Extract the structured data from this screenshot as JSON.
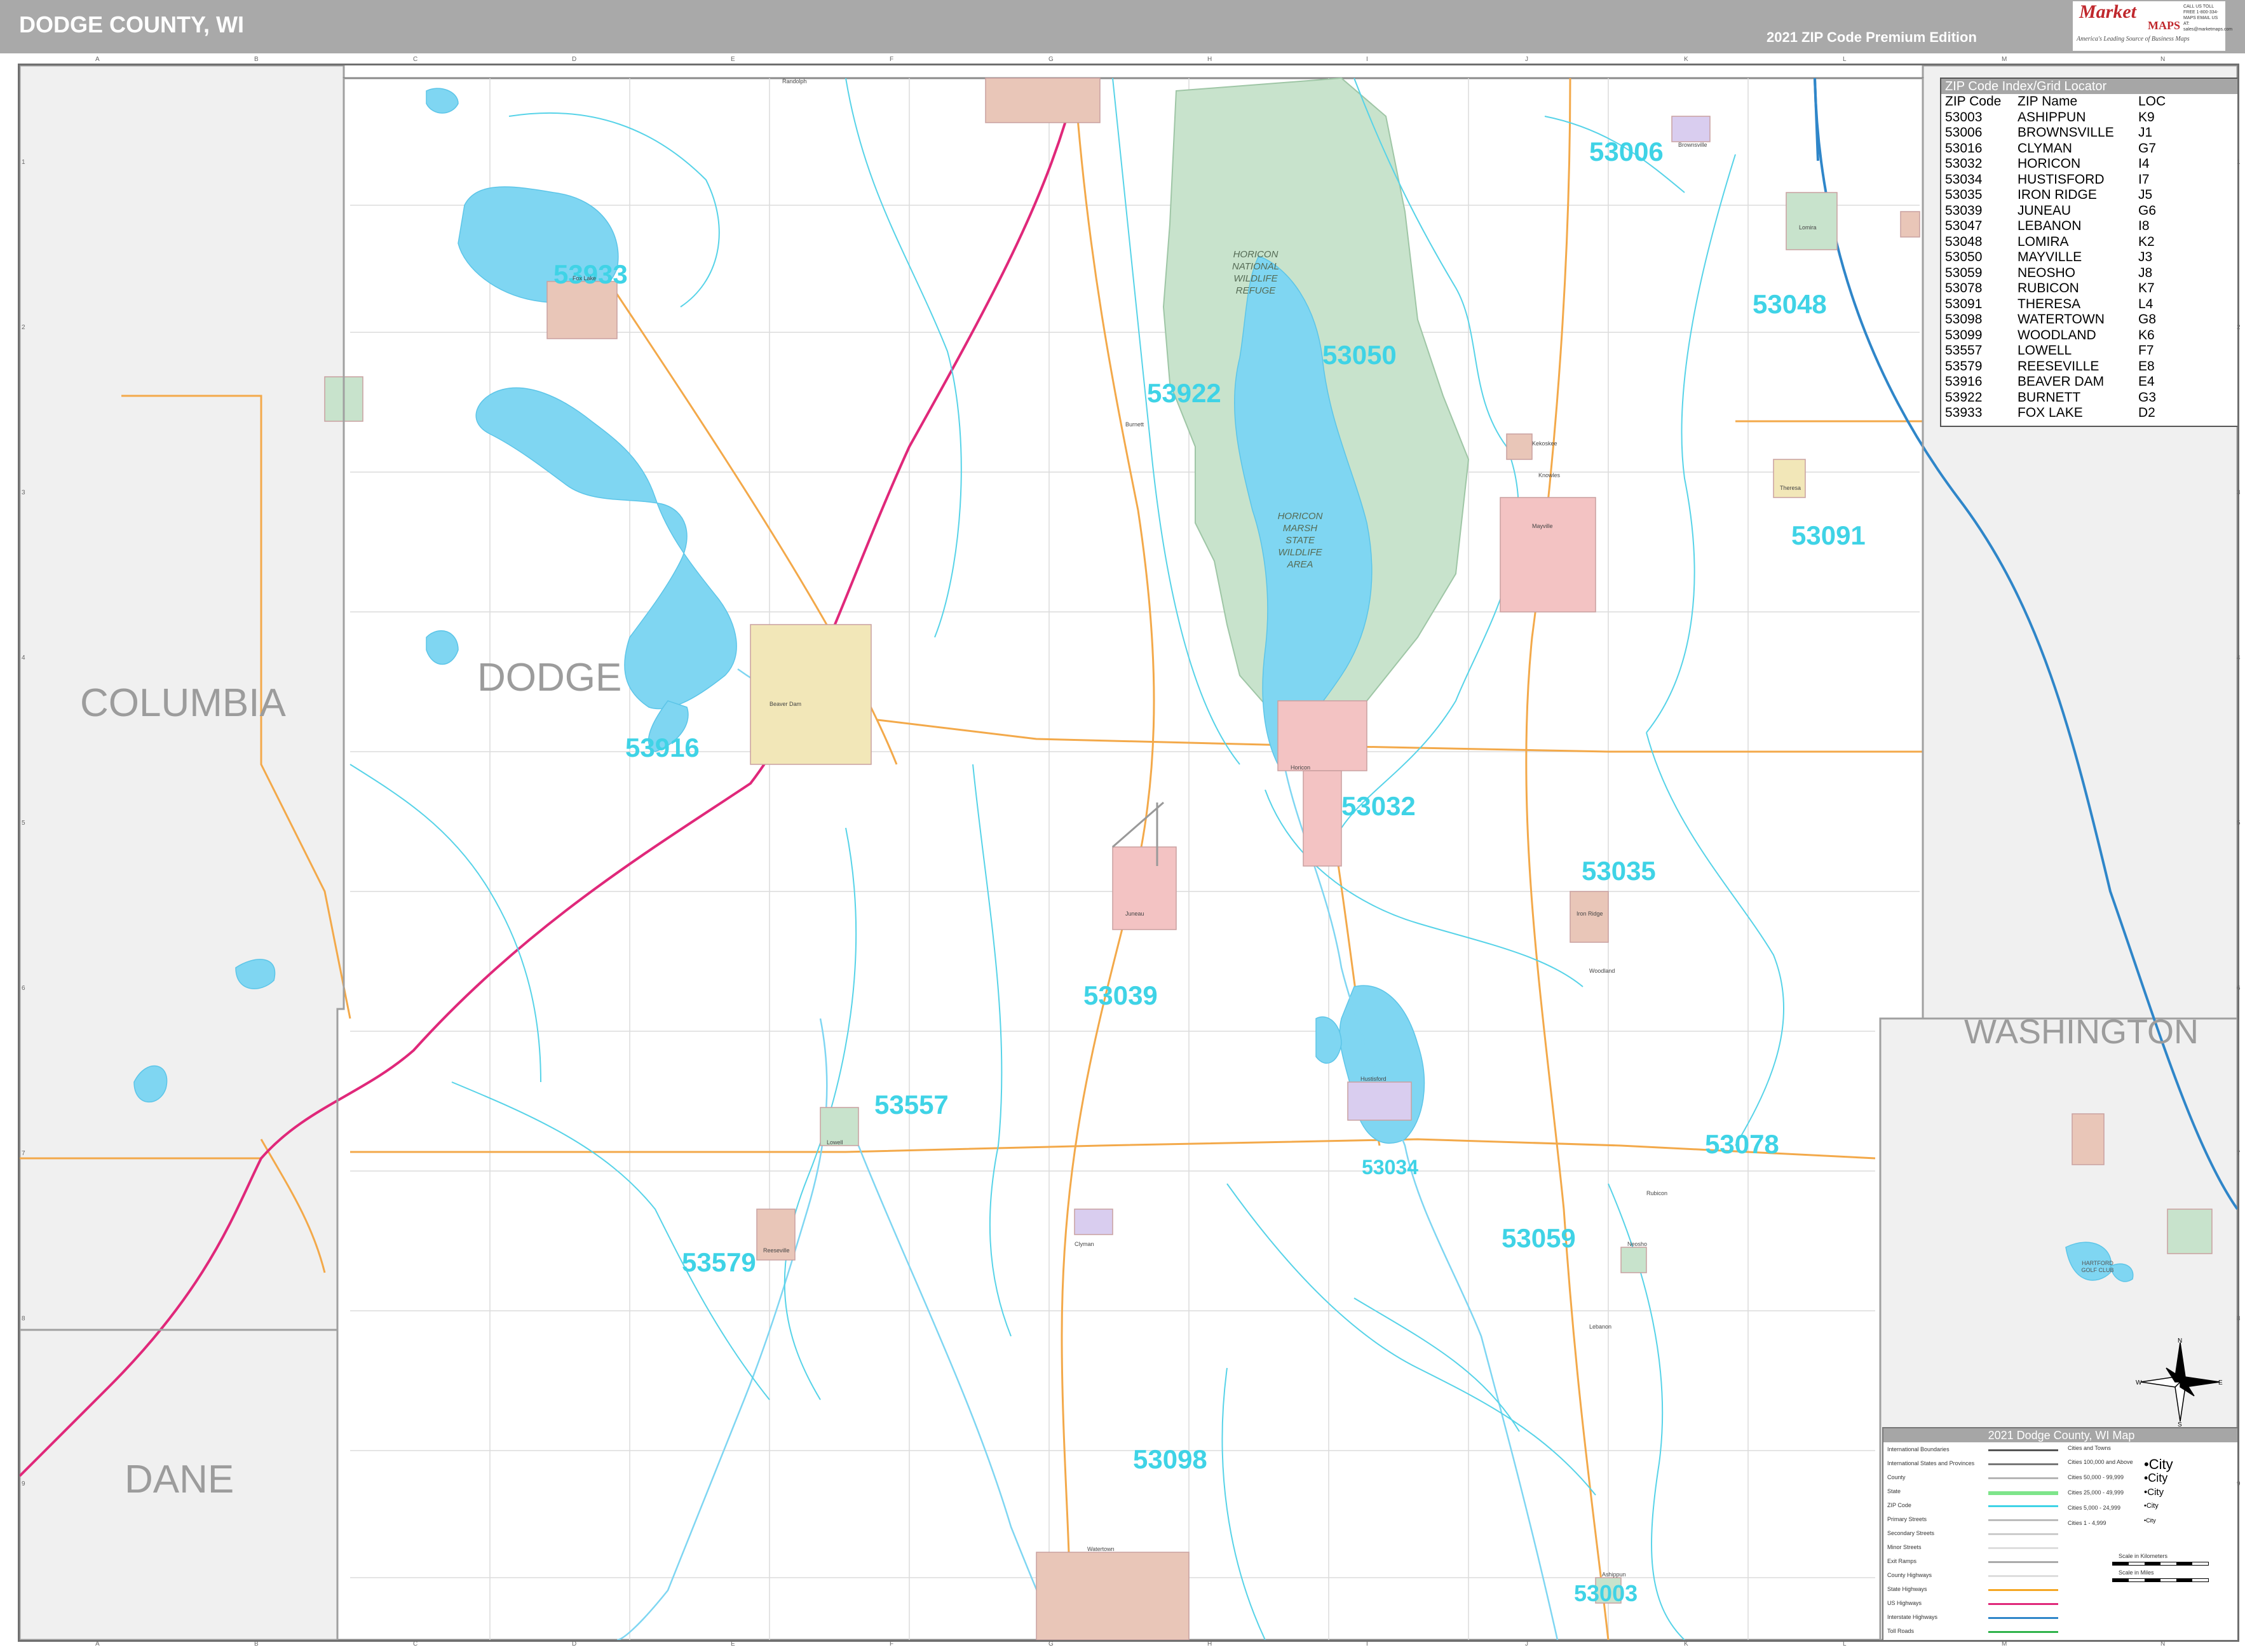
{
  "header": {
    "title": "DODGE COUNTY, WI",
    "edition": "2021 ZIP Code Premium Edition",
    "logo": {
      "brand_top": "Market",
      "brand_bottom": "MAPS",
      "tagline": "America's Leading Source of Business Maps",
      "contact": "CALL US TOLL FREE 1-800-334-MAPS EMAIL US AT: sales@marketmaps.com"
    }
  },
  "grid": {
    "letters": [
      "A",
      "B",
      "C",
      "D",
      "E",
      "F",
      "G",
      "H",
      "I",
      "J",
      "K",
      "L",
      "M",
      "N"
    ],
    "numbers": [
      "1",
      "2",
      "3",
      "4",
      "5",
      "6",
      "7",
      "8",
      "9"
    ]
  },
  "counties": {
    "columbia": "COLUMBIA",
    "dodge": "DODGE",
    "washington": "WASHINGTON",
    "dane": "DANE"
  },
  "zips": {
    "z53006": "53006",
    "z53933": "53933",
    "z53048": "53048",
    "z53050": "53050",
    "z53922": "53922",
    "z53091": "53091",
    "z53916": "53916",
    "z53032": "53032",
    "z53035": "53035",
    "z53039": "53039",
    "z53557": "53557",
    "z53078": "53078",
    "z53034": "53034",
    "z53059": "53059",
    "z53579": "53579",
    "z53098": "53098",
    "z53003": "53003"
  },
  "areas": {
    "horicon_nwr": "HORICON NATIONAL WILDLIFE REFUGE",
    "horicon_marsh": "HORICON MARSH STATE WILDLIFE AREA",
    "hartford_golf": "HARTFORD GOLF CLUB"
  },
  "zip_index": {
    "title": "ZIP Code Index/Grid Locator",
    "columns": [
      "ZIP Code",
      "ZIP Name",
      "LOC"
    ],
    "rows": [
      [
        "53003",
        "ASHIPPUN",
        "K9"
      ],
      [
        "53006",
        "BROWNSVILLE",
        "J1"
      ],
      [
        "53016",
        "CLYMAN",
        "G7"
      ],
      [
        "53032",
        "HORICON",
        "I4"
      ],
      [
        "53034",
        "HUSTISFORD",
        "I7"
      ],
      [
        "53035",
        "IRON RIDGE",
        "J5"
      ],
      [
        "53039",
        "JUNEAU",
        "G6"
      ],
      [
        "53047",
        "LEBANON",
        "I8"
      ],
      [
        "53048",
        "LOMIRA",
        "K2"
      ],
      [
        "53050",
        "MAYVILLE",
        "J3"
      ],
      [
        "53059",
        "NEOSHO",
        "J8"
      ],
      [
        "53078",
        "RUBICON",
        "K7"
      ],
      [
        "53091",
        "THERESA",
        "L4"
      ],
      [
        "53098",
        "WATERTOWN",
        "G8"
      ],
      [
        "53099",
        "WOODLAND",
        "K6"
      ],
      [
        "53557",
        "LOWELL",
        "F7"
      ],
      [
        "53579",
        "REESEVILLE",
        "E8"
      ],
      [
        "53916",
        "BEAVER DAM",
        "E4"
      ],
      [
        "53922",
        "BURNETT",
        "G3"
      ],
      [
        "53933",
        "FOX LAKE",
        "D2"
      ]
    ]
  },
  "legend": {
    "title": "2021 Dodge County, WI Map",
    "left_items": [
      "International Boundaries",
      "International States and Provinces",
      "County",
      "State",
      "ZIP Code",
      "Primary Streets",
      "Secondary Streets",
      "Minor Streets",
      "Exit Ramps",
      "County Highways",
      "State Highways",
      "US Highways",
      "Interstate Highways",
      "Toll Roads"
    ],
    "cities_header": "Cities and Towns",
    "city_items": [
      "Cities 100,000 and Above",
      "Cities 50,000 - 99,999",
      "Cities 25,000 - 49,999",
      "Cities 5,000 - 24,999",
      "Cities 1 - 4,999"
    ],
    "city_samples": [
      "•City",
      "•City",
      "•City",
      "•City",
      "•City"
    ],
    "scale_km": "Scale in Kilometers",
    "scale_mi": "Scale in Miles",
    "colors": {
      "zip": "#3fd3e6",
      "state_hwy": "#f5a623",
      "us_hwy": "#e0287a",
      "interstate": "#2f86c9",
      "county": "#b5b5b5",
      "toll": "#2fb34a"
    }
  },
  "compass": {
    "n": "N",
    "s": "S",
    "e": "E",
    "w": "W"
  },
  "places": [
    "Fox Lake",
    "Randolph",
    "Beaver Dam",
    "Juneau",
    "Horicon",
    "Mayville",
    "Theresa",
    "Lomira",
    "Brownsville",
    "Iron Ridge",
    "Hustisford",
    "Lowell",
    "Reeseville",
    "Clyman",
    "Neosho",
    "Watertown",
    "Ashippun",
    "Burnett",
    "Kekoskee",
    "Rubicon",
    "Woodland",
    "Lebanon",
    "Knowles"
  ],
  "colors": {
    "water": "#7fd6f2",
    "wildlife": "#c8e3cc",
    "zip_line": "#57d3e8",
    "grey_area": "#f0f0f0",
    "city_pink": "#f3c3c3"
  }
}
